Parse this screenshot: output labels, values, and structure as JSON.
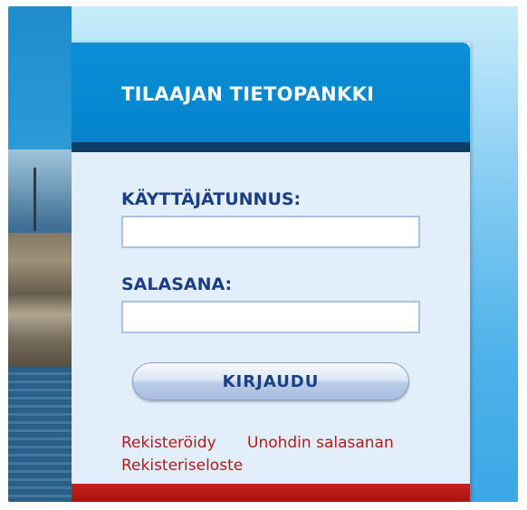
{
  "login_panel": {
    "title": "TILAAJAN TIETOPANKKI",
    "username_label": "KÄYTTÄJÄTUNNUS:",
    "username_value": "",
    "password_label": "SALASANA:",
    "password_value": "",
    "login_button": "KIRJAUDU",
    "links": {
      "register": "Rekisteröidy",
      "forgot_password": "Unohdin salasanan",
      "privacy_statement": "Rekisteriseloste"
    }
  },
  "colors": {
    "header_blue": "#0a8fd6",
    "label_navy": "#1a3f86",
    "link_red": "#b01c1c",
    "footer_red": "#c8231c"
  }
}
